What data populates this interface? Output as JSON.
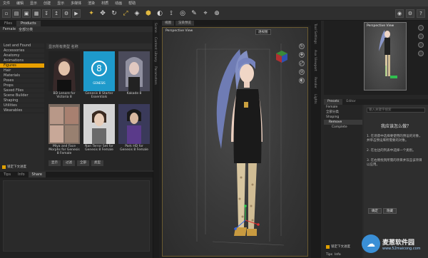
{
  "menu": [
    "文件",
    "编辑",
    "显示",
    "创建",
    "显示",
    "多媒体",
    "渲染",
    "材质",
    "动画",
    "帮助"
  ],
  "toolbar": {
    "file_buttons": [
      "new-file",
      "open-file",
      "save-file",
      "save-as",
      "import",
      "export",
      "render-settings",
      "render"
    ],
    "tools": [
      "universal-tool",
      "translate-tool",
      "rotate-tool",
      "scale-tool",
      "node-weight-tool",
      "geometry-tool",
      "surface-tool",
      "joint-editor",
      "spot-render",
      "text-tool",
      "camera-tool",
      "node-tool"
    ],
    "right_icons": [
      "render-icon",
      "settings-icon",
      "help-icon"
    ]
  },
  "left_panel": {
    "tabs": [
      "Files",
      "Products"
    ],
    "crumb": [
      "Female",
      "全部分类"
    ],
    "sidebar": [
      "Lost and Found",
      "Accessories",
      "Anatomy",
      "Animations",
      "Figures",
      "Hair",
      "Materials",
      "Poses",
      "Props",
      "Saved Files",
      "Scene Builder",
      "Shaping",
      "Utilities",
      "Wearables"
    ],
    "selected": "Figures",
    "grid_header": "显示所有类型 名称",
    "items": [
      {
        "caption": "BD Lenore for Victoria 8",
        "color": "#2a2a2a"
      },
      {
        "caption": "Genesis 8 Starter Essentials",
        "color": "#1e9acb"
      },
      {
        "caption": "Kakade 8",
        "color": "#6a6a7a"
      },
      {
        "caption": "Miya and Face Morphs for Genesis 8 Female",
        "color": "#8a6a5a"
      },
      {
        "caption": "Nan Terror Set for Genesis 8 Female",
        "color": "#c8c8c8"
      },
      {
        "caption": "Park HD for Genesis 8 Female",
        "color": "#4a4a7a"
      }
    ],
    "grid_footer": [
      "显示",
      "过滤",
      "全部",
      "类型"
    ],
    "checkbox_label": "锁定下文进度"
  },
  "bottom_left": {
    "tabs": [
      "Tips",
      "Info",
      "Share"
    ]
  },
  "left_strip": [
    "Scene",
    "Content Library",
    "Parameters"
  ],
  "viewport": {
    "tabs": [
      "视图",
      "渲染预览"
    ],
    "label": "Perspective View",
    "dropdown": "透视图",
    "nav": [
      "↻",
      "✥",
      "⤢",
      "⊙",
      "◐"
    ]
  },
  "right_strip": [
    "Tool Settings",
    "Aux Viewport",
    "Render",
    "Lights"
  ],
  "aux": {
    "label": "Perspective View"
  },
  "params": {
    "tabs": [
      "Presets",
      "Editor"
    ],
    "tree": [
      "Female",
      "全部分类",
      "Shaping",
      "Remove",
      "Complete"
    ],
    "highlight": "Remove",
    "search": "输入关键字搜索",
    "title": "我应该怎么做？",
    "steps": [
      "1. 在场景中选择要使用的预设的对象，并单击预设库所需要的对象。",
      "2. 在左边的列表中选择一个类别。",
      "3. 在右侧找到所需的项目并双击该项目以应用。"
    ],
    "buttons": [
      "确定",
      "隐藏"
    ],
    "checkbox_label": "锁定下文进度",
    "bottom_tabs": [
      "Tips",
      "Info"
    ]
  },
  "watermark": {
    "name": "麦葱软件园",
    "url": "www.52maicong.com"
  }
}
